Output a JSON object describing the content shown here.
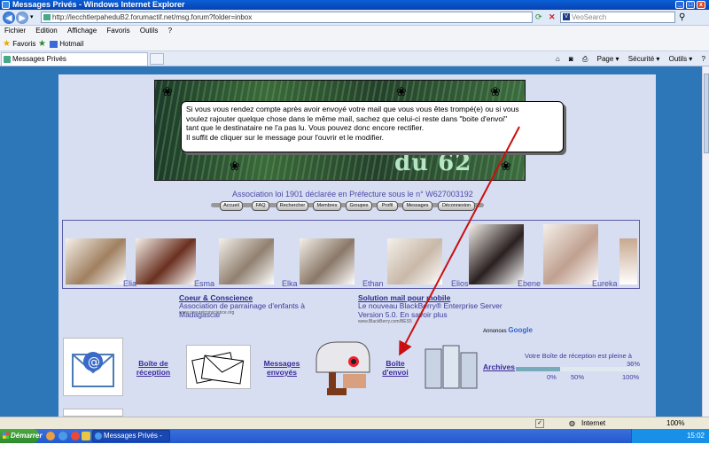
{
  "window": {
    "title": "Messages Privés - Windows Internet Explorer"
  },
  "browser": {
    "address": "http://lecchtlerpaheduB2.forumactif.net/msg.forum?folder=inbox",
    "search_placeholder": "VeoSearch",
    "menu": [
      "Fichier",
      "Edition",
      "Affichage",
      "Favoris",
      "Outils",
      "?"
    ],
    "favorites_label": "Favoris",
    "favorites_link": "Hotmail",
    "tab_label": "Messages Privés",
    "commands": [
      "Page ▾",
      "Sécurité ▾",
      "Outils ▾",
      "?"
    ]
  },
  "banner": {
    "logo_text": "du 62"
  },
  "tooltip": {
    "lines": [
      "Si vous vous rendez compte après avoir envoyé votre mail que vous vous êtes trompé(e) ou si vous",
      "voulez rajouter quelque chose dans le même mail, sachez que celui-ci reste dans \"boite d'envoi\"",
      "tant que le destinataire ne l'a pas lu. Vous pouvez donc encore rectifier.",
      "Il suffit de cliquer sur le message pour l'ouvrir et le modifier."
    ]
  },
  "association": "Association loi 1901 déclarée en Préfecture sous le n° W627003192",
  "nav_buttons": [
    "Accueil",
    "FAQ",
    "Rechercher",
    "Membres",
    "Groupes",
    "Profil",
    "Messages",
    "Déconnexion"
  ],
  "gallery": {
    "cats": [
      {
        "name": "Elia",
        "color": "#a08060"
      },
      {
        "name": "Esma",
        "color": "#6a3020"
      },
      {
        "name": "Elka",
        "color": "#908070"
      },
      {
        "name": "Ethan",
        "color": "#8a7868"
      },
      {
        "name": "Elios",
        "color": "#c8b8a8"
      },
      {
        "name": "Ebene",
        "color": "#2a2020"
      },
      {
        "name": "Eureka",
        "color": "#c0a090"
      }
    ]
  },
  "ads": [
    {
      "title": "Coeur & Conscience",
      "text": "Association de parrainage d'enfants à Madagascar",
      "url": "www.coeuretconscience.org"
    },
    {
      "title": "Solution mail pour mobile",
      "text": "Le nouveau BlackBerry® Enterprise Server Version 5.0. En savoir plus",
      "url": "www.BlackBerry.com/BES5"
    }
  ],
  "annonces": {
    "label": "Annonces",
    "brand": "Google"
  },
  "folders": [
    {
      "label": "Boîte de réception"
    },
    {
      "label": "Messages envoyés"
    },
    {
      "label": "Boîte d'envoi"
    },
    {
      "label": "Archives"
    }
  ],
  "quota": {
    "text": "Votre Boîte de réception est pleine à",
    "percent": "36%",
    "fill_fraction": 0.36,
    "scale": [
      "0%",
      "50%",
      "100%"
    ]
  },
  "status": {
    "zone": "Internet",
    "zoom": "100%"
  },
  "taskbar": {
    "start": "Démarrer",
    "item": "Messages Privés - W...",
    "clock": "15:02"
  }
}
